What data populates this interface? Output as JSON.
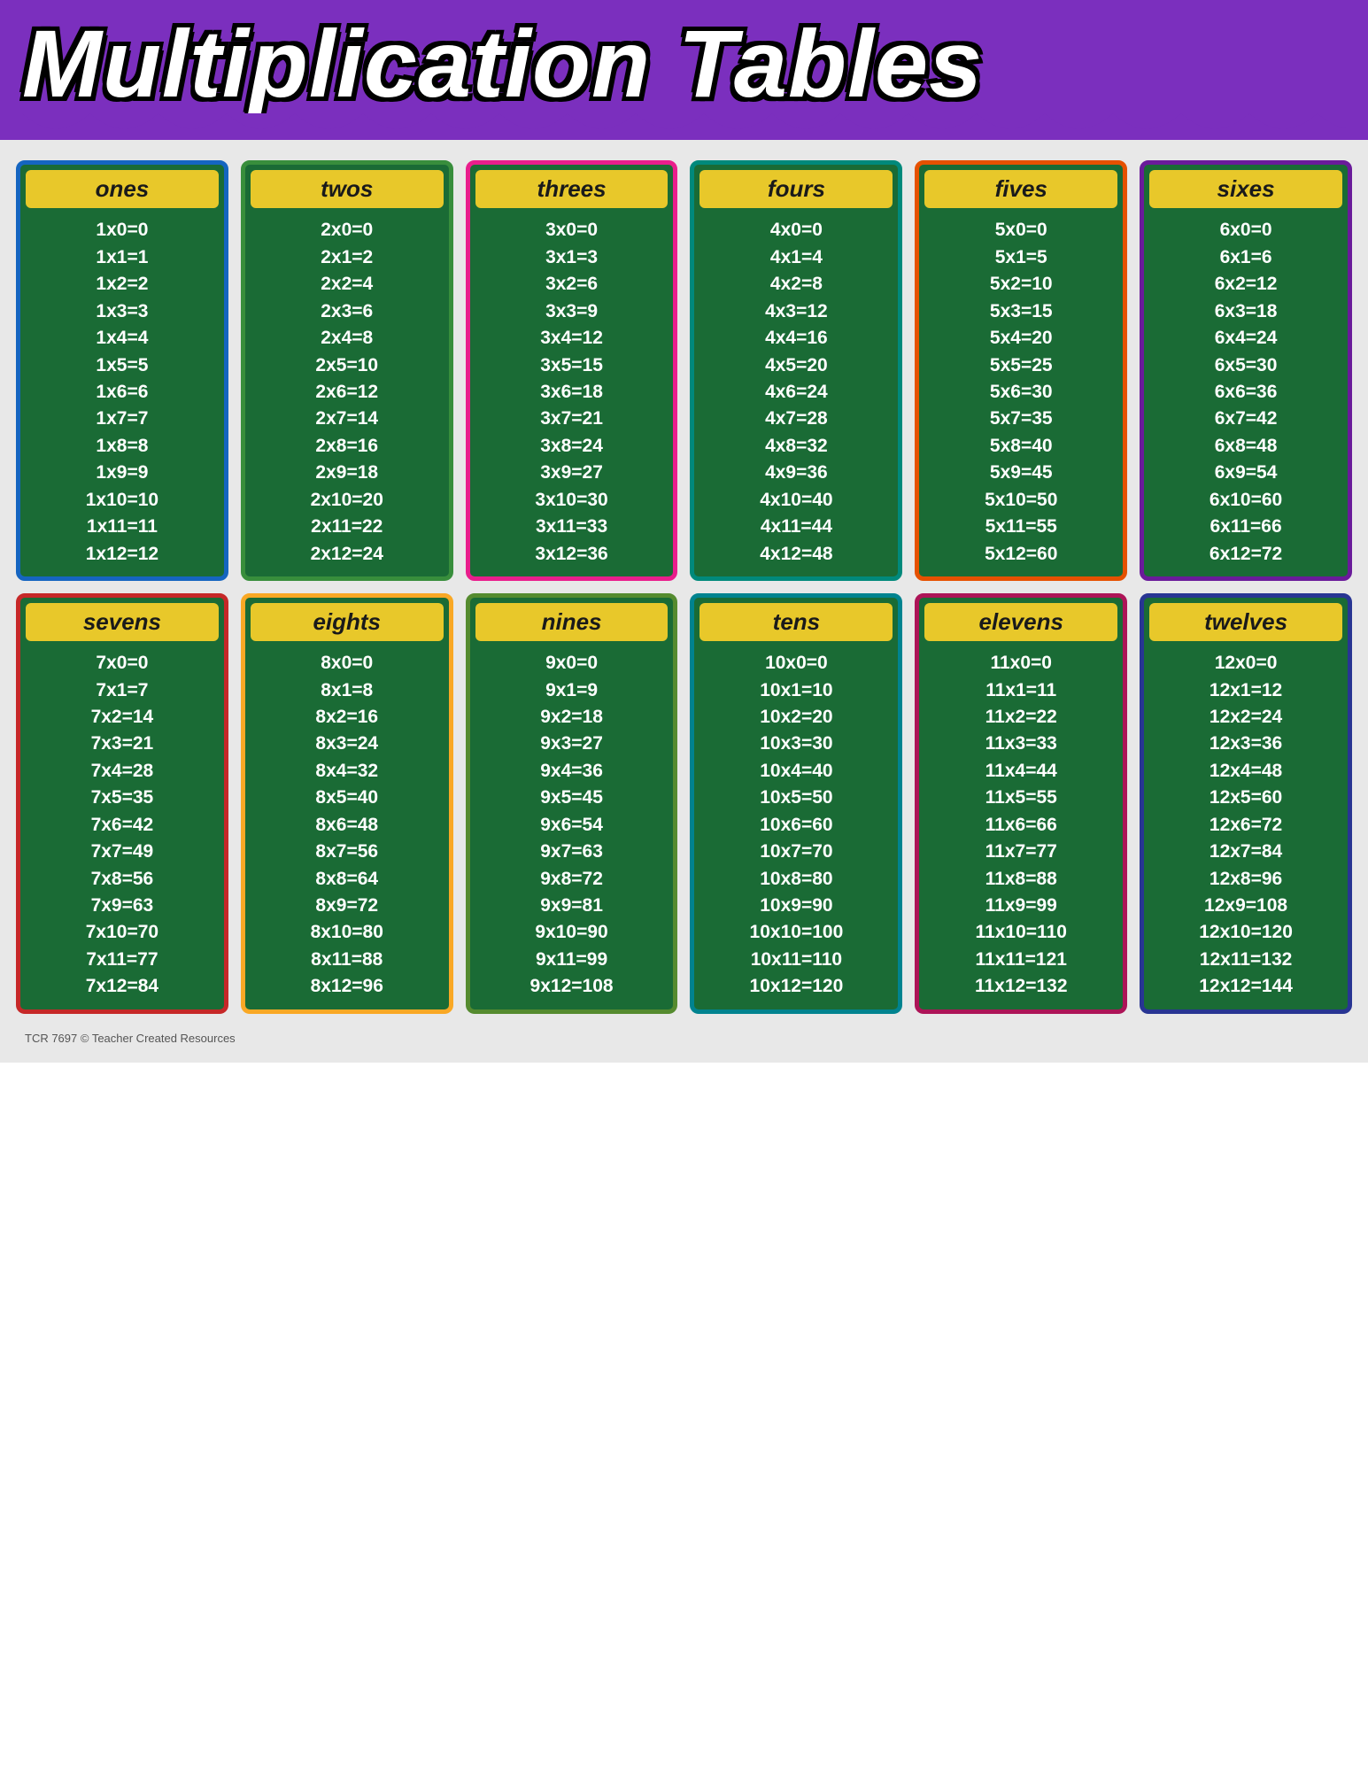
{
  "header": {
    "title": "Multiplication Tables",
    "bg_color": "#7b2fbe"
  },
  "tables": [
    {
      "id": "ones",
      "label": "ones",
      "border": "blue-border",
      "multiplier": 1,
      "rows": [
        "1x0=0",
        "1x1=1",
        "1x2=2",
        "1x3=3",
        "1x4=4",
        "1x5=5",
        "1x6=6",
        "1x7=7",
        "1x8=8",
        "1x9=9",
        "1x10=10",
        "1x11=11",
        "1x12=12"
      ]
    },
    {
      "id": "twos",
      "label": "twos",
      "border": "green-border",
      "multiplier": 2,
      "rows": [
        "2x0=0",
        "2x1=2",
        "2x2=4",
        "2x3=6",
        "2x4=8",
        "2x5=10",
        "2x6=12",
        "2x7=14",
        "2x8=16",
        "2x9=18",
        "2x10=20",
        "2x11=22",
        "2x12=24"
      ]
    },
    {
      "id": "threes",
      "label": "threes",
      "border": "pink-border",
      "multiplier": 3,
      "rows": [
        "3x0=0",
        "3x1=3",
        "3x2=6",
        "3x3=9",
        "3x4=12",
        "3x5=15",
        "3x6=18",
        "3x7=21",
        "3x8=24",
        "3x9=27",
        "3x10=30",
        "3x11=33",
        "3x12=36"
      ]
    },
    {
      "id": "fours",
      "label": "fours",
      "border": "teal-border",
      "multiplier": 4,
      "rows": [
        "4x0=0",
        "4x1=4",
        "4x2=8",
        "4x3=12",
        "4x4=16",
        "4x5=20",
        "4x6=24",
        "4x7=28",
        "4x8=32",
        "4x9=36",
        "4x10=40",
        "4x11=44",
        "4x12=48"
      ]
    },
    {
      "id": "fives",
      "label": "fives",
      "border": "orange-border",
      "multiplier": 5,
      "rows": [
        "5x0=0",
        "5x1=5",
        "5x2=10",
        "5x3=15",
        "5x4=20",
        "5x5=25",
        "5x6=30",
        "5x7=35",
        "5x8=40",
        "5x9=45",
        "5x10=50",
        "5x11=55",
        "5x12=60"
      ]
    },
    {
      "id": "sixes",
      "label": "sixes",
      "border": "purple-border",
      "multiplier": 6,
      "rows": [
        "6x0=0",
        "6x1=6",
        "6x2=12",
        "6x3=18",
        "6x4=24",
        "6x5=30",
        "6x6=36",
        "6x7=42",
        "6x8=48",
        "6x9=54",
        "6x10=60",
        "6x11=66",
        "6x12=72"
      ]
    },
    {
      "id": "sevens",
      "label": "sevens",
      "border": "red-border",
      "multiplier": 7,
      "rows": [
        "7x0=0",
        "7x1=7",
        "7x2=14",
        "7x3=21",
        "7x4=28",
        "7x5=35",
        "7x6=42",
        "7x7=49",
        "7x8=56",
        "7x9=63",
        "7x10=70",
        "7x11=77",
        "7x12=84"
      ]
    },
    {
      "id": "eights",
      "label": "eights",
      "border": "yellow-border",
      "multiplier": 8,
      "rows": [
        "8x0=0",
        "8x1=8",
        "8x2=16",
        "8x3=24",
        "8x4=32",
        "8x5=40",
        "8x6=48",
        "8x7=56",
        "8x8=64",
        "8x9=72",
        "8x10=80",
        "8x11=88",
        "8x12=96"
      ]
    },
    {
      "id": "nines",
      "label": "nines",
      "border": "lime-border",
      "multiplier": 9,
      "rows": [
        "9x0=0",
        "9x1=9",
        "9x2=18",
        "9x3=27",
        "9x4=36",
        "9x5=45",
        "9x6=54",
        "9x7=63",
        "9x8=72",
        "9x9=81",
        "9x10=90",
        "9x11=99",
        "9x12=108"
      ]
    },
    {
      "id": "tens",
      "label": "tens",
      "border": "cyan-border",
      "multiplier": 10,
      "rows": [
        "10x0=0",
        "10x1=10",
        "10x2=20",
        "10x3=30",
        "10x4=40",
        "10x5=50",
        "10x6=60",
        "10x7=70",
        "10x8=80",
        "10x9=90",
        "10x10=100",
        "10x11=110",
        "10x12=120"
      ]
    },
    {
      "id": "elevens",
      "label": "elevens",
      "border": "magenta-border",
      "multiplier": 11,
      "rows": [
        "11x0=0",
        "11x1=11",
        "11x2=22",
        "11x3=33",
        "11x4=44",
        "11x5=55",
        "11x6=66",
        "11x7=77",
        "11x8=88",
        "11x9=99",
        "11x10=110",
        "11x11=121",
        "11x12=132"
      ]
    },
    {
      "id": "twelves",
      "label": "twelves",
      "border": "indigo-border",
      "multiplier": 12,
      "rows": [
        "12x0=0",
        "12x1=12",
        "12x2=24",
        "12x3=36",
        "12x4=48",
        "12x5=60",
        "12x6=72",
        "12x7=84",
        "12x8=96",
        "12x9=108",
        "12x10=120",
        "12x11=132",
        "12x12=144"
      ]
    }
  ],
  "footer": {
    "text": "TCR 7697  © Teacher Created Resources"
  }
}
